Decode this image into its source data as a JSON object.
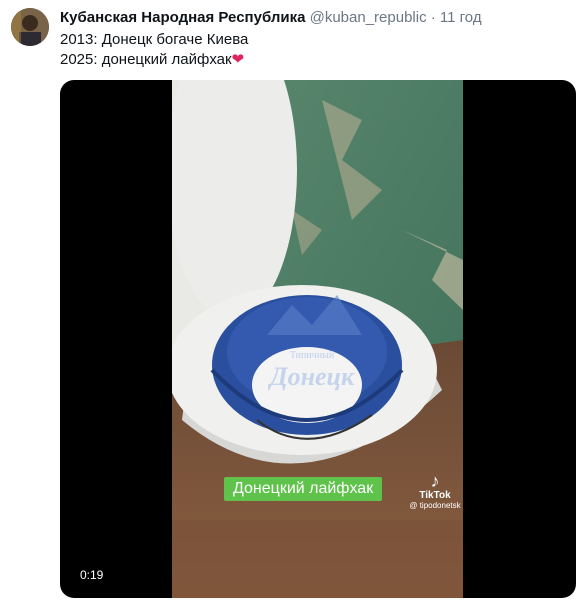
{
  "tweet": {
    "author": "Кубанская Народная Республика",
    "handle": "@kuban_republic",
    "separator": "·",
    "time": "11 год",
    "lines": [
      "2013: Донецк богаче Киева",
      "2025: донецкий лайфхак"
    ],
    "heart": "❤"
  },
  "media": {
    "timer": "0:19",
    "caption": "Донецкий лайфхак",
    "watermark": "Типичный Донецк",
    "tiktok_logo": "♪",
    "tiktok_brand": "TikTok",
    "tiktok_user": "@ tipodonetsk"
  },
  "icons": {
    "tiktok": "music-note-icon"
  },
  "colors": {
    "caption_bg": "#5fc24a",
    "heart": "#e0245e",
    "handle": "#6b7784"
  }
}
